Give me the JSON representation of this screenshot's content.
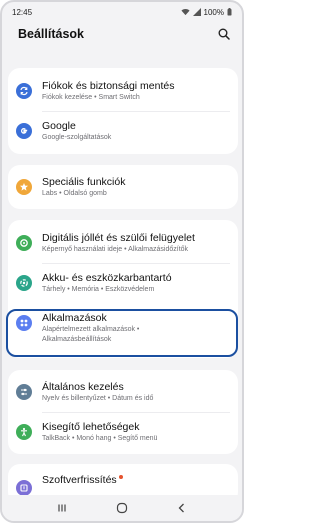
{
  "status_bar": {
    "time": "12:45",
    "battery": "100%"
  },
  "header": {
    "title": "Beállítások",
    "search_icon": "search-icon"
  },
  "items": [
    {
      "id": "accounts",
      "title": "Fiókok és biztonsági mentés",
      "subtitle": "Fiókok kezelése  •  Smart Switch",
      "icon": "sync-icon",
      "color": "#3a6fd8"
    },
    {
      "id": "google",
      "title": "Google",
      "subtitle": "Google-szolgáltatások",
      "icon": "google-icon",
      "color": "#3a6fd8"
    },
    {
      "id": "advanced",
      "title": "Speciális funkciók",
      "subtitle": "Labs  •  Oldalsó gomb",
      "icon": "star-icon",
      "color": "#f0a73a"
    },
    {
      "id": "wellbeing",
      "title": "Digitális jóllét és szülői felügyelet",
      "subtitle": "Képernyő használati ideje  •  Alkalmazásidőzítők",
      "icon": "wellbeing-icon",
      "color": "#3fae59"
    },
    {
      "id": "care",
      "title": "Akku- és eszközkarbantartó",
      "subtitle": "Tárhely  •  Memória  •  Eszközvédelem",
      "icon": "care-icon",
      "color": "#2ba58a"
    },
    {
      "id": "apps",
      "title": "Alkalmazások",
      "subtitle": "Alapértelmezett alkalmazások  •",
      "subtitle2": "Alkalmazásbeállítások",
      "icon": "apps-icon",
      "color": "#5b7ef0"
    },
    {
      "id": "general",
      "title": "Általános kezelés",
      "subtitle": "Nyelv és billentyűzet  •  Dátum és idő",
      "icon": "sliders-icon",
      "color": "#607d96"
    },
    {
      "id": "accessibility",
      "title": "Kisegítő lehetőségek",
      "subtitle": "TalkBack  •  Monó hang  •  Segítő menü",
      "icon": "accessibility-icon",
      "color": "#3fae59"
    },
    {
      "id": "update",
      "title": "Szoftverfrissítés",
      "subtitle": "",
      "icon": "update-icon",
      "color": "#7b6fd6"
    }
  ],
  "nav": {
    "recents": "recents-icon",
    "home": "home-icon",
    "back": "back-icon"
  }
}
